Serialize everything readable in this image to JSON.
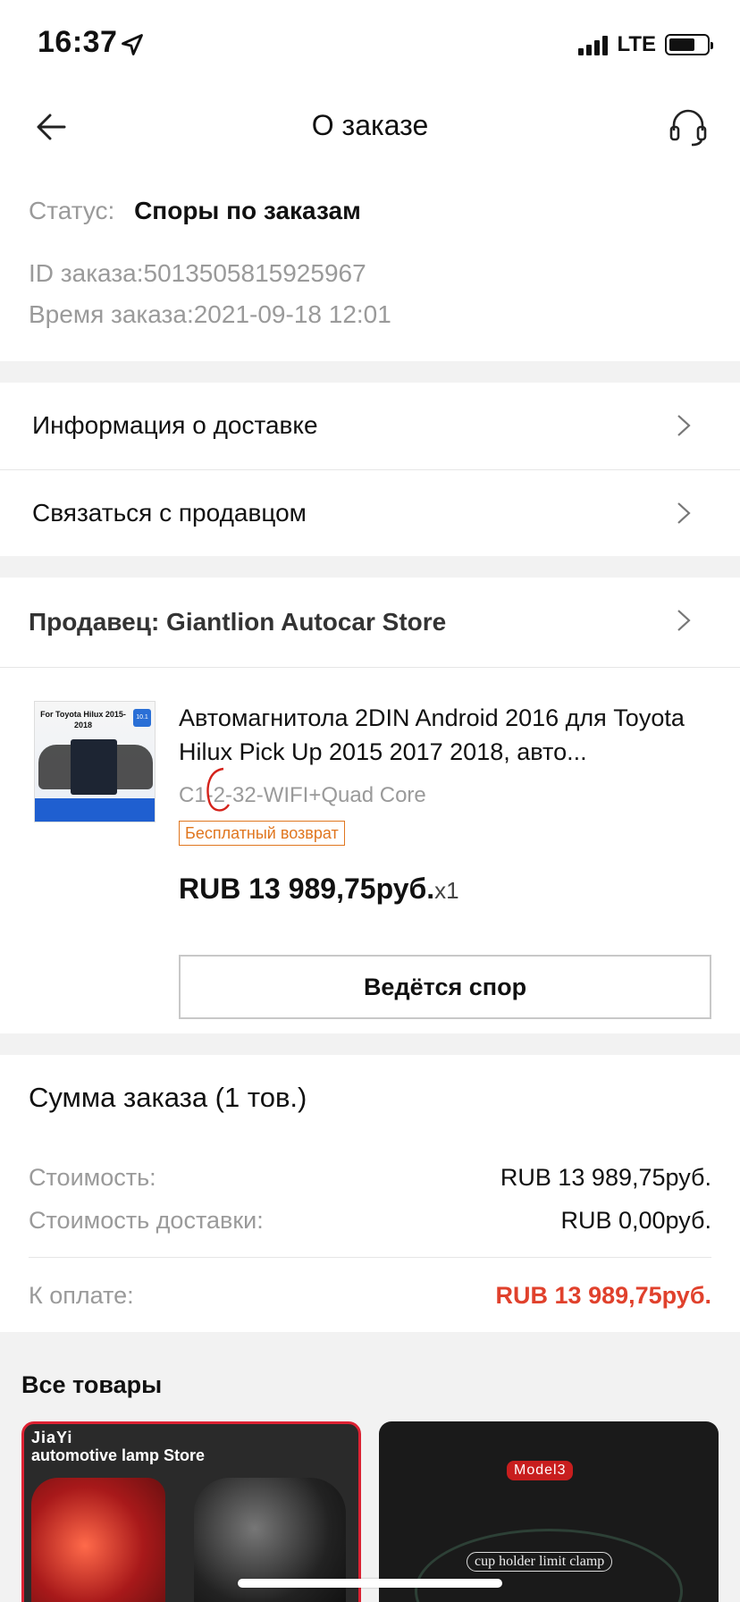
{
  "status_bar": {
    "time": "16:37",
    "network": "LTE"
  },
  "nav": {
    "title": "О заказе"
  },
  "order": {
    "status_label": "Статус:",
    "status_value": "Споры по заказам",
    "id_line": "ID заказа:5013505815925967",
    "time_line": "Время заказа:2021-09-18 12:01"
  },
  "links": {
    "delivery": "Информация о доставке",
    "contact_seller": "Связаться с продавцом"
  },
  "seller": {
    "label": "Продавец: Giantlion Autocar Store"
  },
  "product": {
    "thumb_title": "For Toyota Hilux 2015-2018",
    "thumb_badge": "10.1",
    "title": "Автомагнитола 2DIN Android 2016 для Toyota Hilux Pick Up 2015 2017 2018, авто...",
    "variant": "C1-2-32-WIFI+Quad Core",
    "badge": "Бесплатный возврат",
    "price": "RUB 13 989,75руб.",
    "qty": "x1",
    "action": "Ведётся спор"
  },
  "summary": {
    "title": "Сумма заказа (1 тов.)",
    "cost_label": "Стоимость:",
    "cost_value": "RUB 13 989,75руб.",
    "shipping_label": "Стоимость доставки:",
    "shipping_value": "RUB 0,00руб.",
    "total_label": "К оплате:",
    "total_value": "RUB 13 989,75руб."
  },
  "all_products": {
    "title": "Все товары",
    "cards": [
      {
        "store_line1": "JiaYi",
        "store_line2": "automotive lamp Store"
      },
      {
        "badge": "Model3",
        "label": "cup holder limit clamp"
      }
    ]
  },
  "colors": {
    "accent_red": "#e0412c",
    "badge_orange": "#e0761f",
    "muted_text": "#9a9a9a"
  },
  "icons": [
    "location-arrow-icon",
    "signal-icon",
    "battery-icon",
    "back-arrow-icon",
    "support-headset-icon",
    "chevron-right-icon"
  ]
}
